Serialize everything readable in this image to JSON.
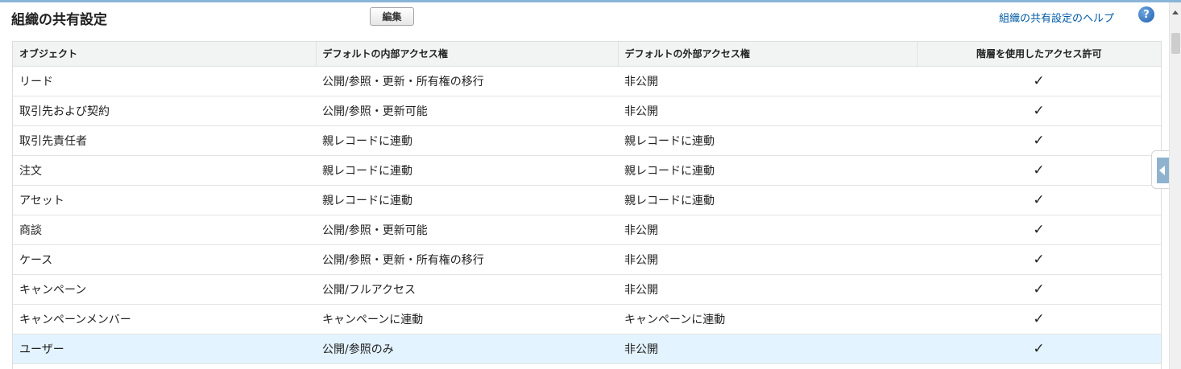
{
  "header": {
    "title": "組織の共有設定",
    "edit_label": "編集",
    "help_label": "組織の共有設定のヘルプ",
    "help_icon": "?"
  },
  "table": {
    "columns": [
      "オブジェクト",
      "デフォルトの内部アクセス権",
      "デフォルトの外部アクセス権",
      "階層を使用したアクセス許可"
    ],
    "rows": [
      [
        "リード",
        "公開/参照・更新・所有権の移行",
        "非公開",
        "✓"
      ],
      [
        "取引先および契約",
        "公開/参照・更新可能",
        "非公開",
        "✓"
      ],
      [
        "取引先責任者",
        "親レコードに連動",
        "親レコードに連動",
        "✓"
      ],
      [
        "注文",
        "親レコードに連動",
        "親レコードに連動",
        "✓"
      ],
      [
        "アセット",
        "親レコードに連動",
        "親レコードに連動",
        "✓"
      ],
      [
        "商談",
        "公開/参照・更新可能",
        "非公開",
        "✓"
      ],
      [
        "ケース",
        "公開/参照・更新・所有権の移行",
        "非公開",
        "✓"
      ],
      [
        "キャンペーン",
        "公開/フルアクセス",
        "非公開",
        "✓"
      ],
      [
        "キャンペーンメンバー",
        "キャンペーンに連動",
        "キャンペーンに連動",
        "✓"
      ],
      [
        "ユーザー",
        "公開/参照のみ",
        "非公開",
        "✓"
      ]
    ],
    "selected_row": 9
  },
  "colors": {
    "link": "#015ba7",
    "selected_row_bg": "#e3f3ff",
    "header_bg": "#f2f3f3"
  }
}
